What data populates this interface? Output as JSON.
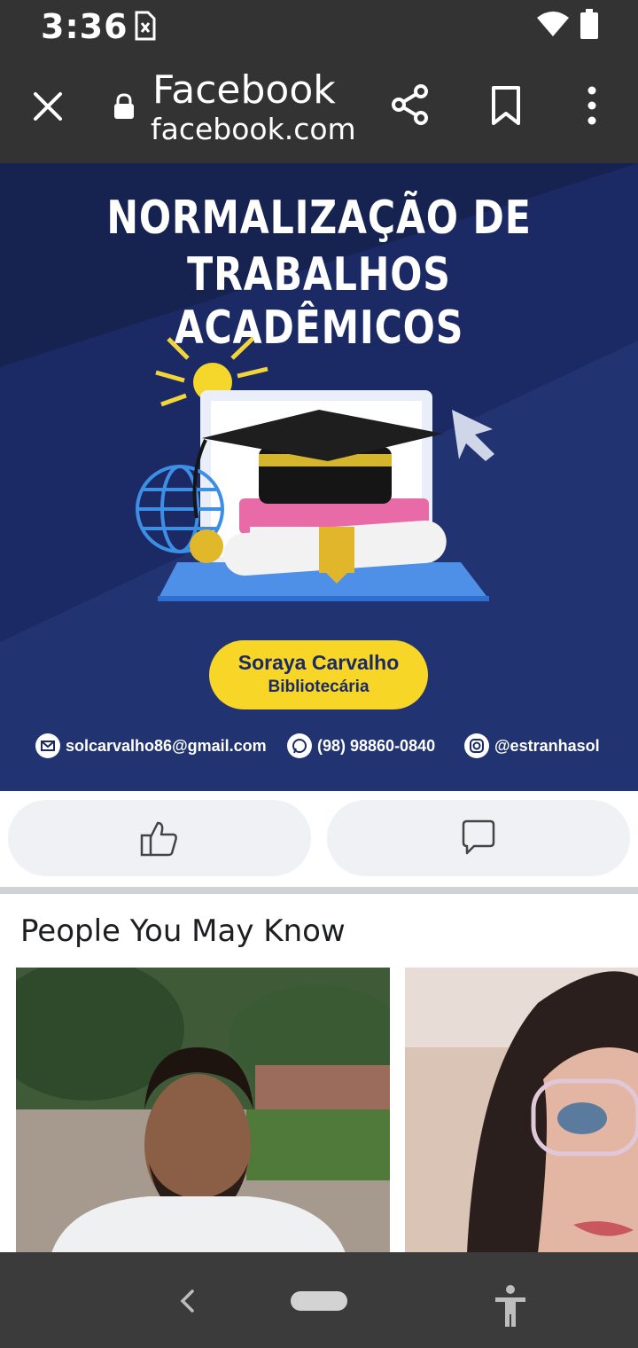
{
  "status_bar": {
    "time": "3:36"
  },
  "toolbar": {
    "title": "Facebook",
    "url": "facebook.com"
  },
  "banner": {
    "title_line1": "NORMALIZAÇÃO DE",
    "title_line2": "TRABALHOS ACADÊMICOS",
    "name": "Soraya Carvalho",
    "role": "Bibliotecária",
    "email": "solcarvalho86@gmail.com",
    "phone": "(98) 98860-0840",
    "instagram": "@estranhasol"
  },
  "actions": {
    "like_icon": "thumbs-up-icon",
    "comment_icon": "comment-icon"
  },
  "section": {
    "title": "People You May Know"
  },
  "colors": {
    "bars": "#333333",
    "banner_bg": "#1b2a64",
    "pill": "#f7d628",
    "action_bg": "#eff1f4"
  }
}
